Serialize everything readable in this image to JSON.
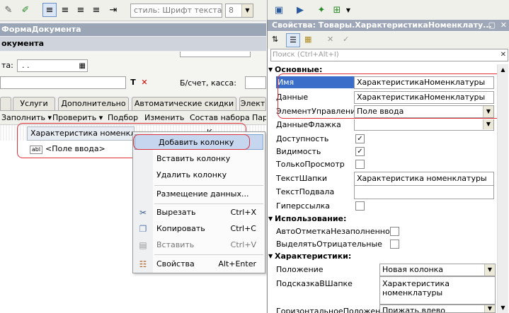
{
  "toolbar": {
    "style_combo": "стиль: Шрифт текста",
    "size_combo": "8"
  },
  "form": {
    "title": "ФормаДокумента",
    "subtitle": "окумента",
    "date_label": "та:",
    "date_value": ". .",
    "bschet_label": "Б/счет, касса:",
    "t_btn": "T",
    "x_btn": "✕"
  },
  "tabs": [
    "Услуги",
    "Дополнительно",
    "Автоматические скидки",
    "Элект"
  ],
  "cmdbar": [
    "Заполнить ▾",
    "Проверить ▾",
    "Подбор",
    "Изменить",
    "Состав набора",
    "Пар"
  ],
  "grid": {
    "header": "Характеристика номенклату",
    "header2": "К",
    "cell_icon": "abl",
    "cell_text": "<Поле ввода>"
  },
  "context_menu": {
    "items": [
      {
        "label": "Добавить колонку",
        "shortcut": "",
        "icon": ""
      },
      {
        "label": "Вставить колонку",
        "shortcut": "",
        "icon": ""
      },
      {
        "label": "Удалить колонку",
        "shortcut": "",
        "icon": ""
      },
      {
        "label": "Размещение данных...",
        "shortcut": "",
        "icon": ""
      },
      {
        "label": "Вырезать",
        "shortcut": "Ctrl+X",
        "icon": "scissors-icon"
      },
      {
        "label": "Копировать",
        "shortcut": "Ctrl+C",
        "icon": "copy-icon"
      },
      {
        "label": "Вставить",
        "shortcut": "Ctrl+V",
        "icon": "paste-icon"
      },
      {
        "label": "Свойства",
        "shortcut": "Alt+Enter",
        "icon": "properties-icon"
      }
    ]
  },
  "props": {
    "title": "Свойства: Товары.ХарактеристикаНоменклату...",
    "search_placeholder": "Поиск (Ctrl+Alt+I)",
    "sections": {
      "basic": "Основные:",
      "usage": "Использование:",
      "characteristics": "Характеристики:"
    },
    "rows": {
      "name_label": "Имя",
      "name_value": "ХарактеристикаНоменклатуры",
      "data_label": "Данные",
      "data_value": "ХарактеристикаНоменклатуры",
      "control_label": "ЭлементУправления",
      "control_value": "Поле ввода",
      "flag_label": "ДанныеФлажка",
      "access_label": "Доступность",
      "visible_label": "Видимость",
      "readonly_label": "ТолькоПросмотр",
      "header_text_label": "ТекстШапки",
      "header_text_value": "Характеристика номенклатуры",
      "footer_text_label": "ТекстПодвала",
      "hyperlink_label": "Гиперссылка",
      "automark_label": "АвтоОтметкаНезаполненного",
      "highlight_label": "ВыделятьОтрицательные",
      "position_label": "Положение",
      "position_value": "Новая колонка",
      "hint_label": "ПодсказкаВШапке",
      "hint_value_1": "Характеристика",
      "hint_value_2": "номенклатуры",
      "halign_label": "ГоризонтальноеПоложение",
      "halign_value": "Прижать влево"
    },
    "check": "✓"
  }
}
